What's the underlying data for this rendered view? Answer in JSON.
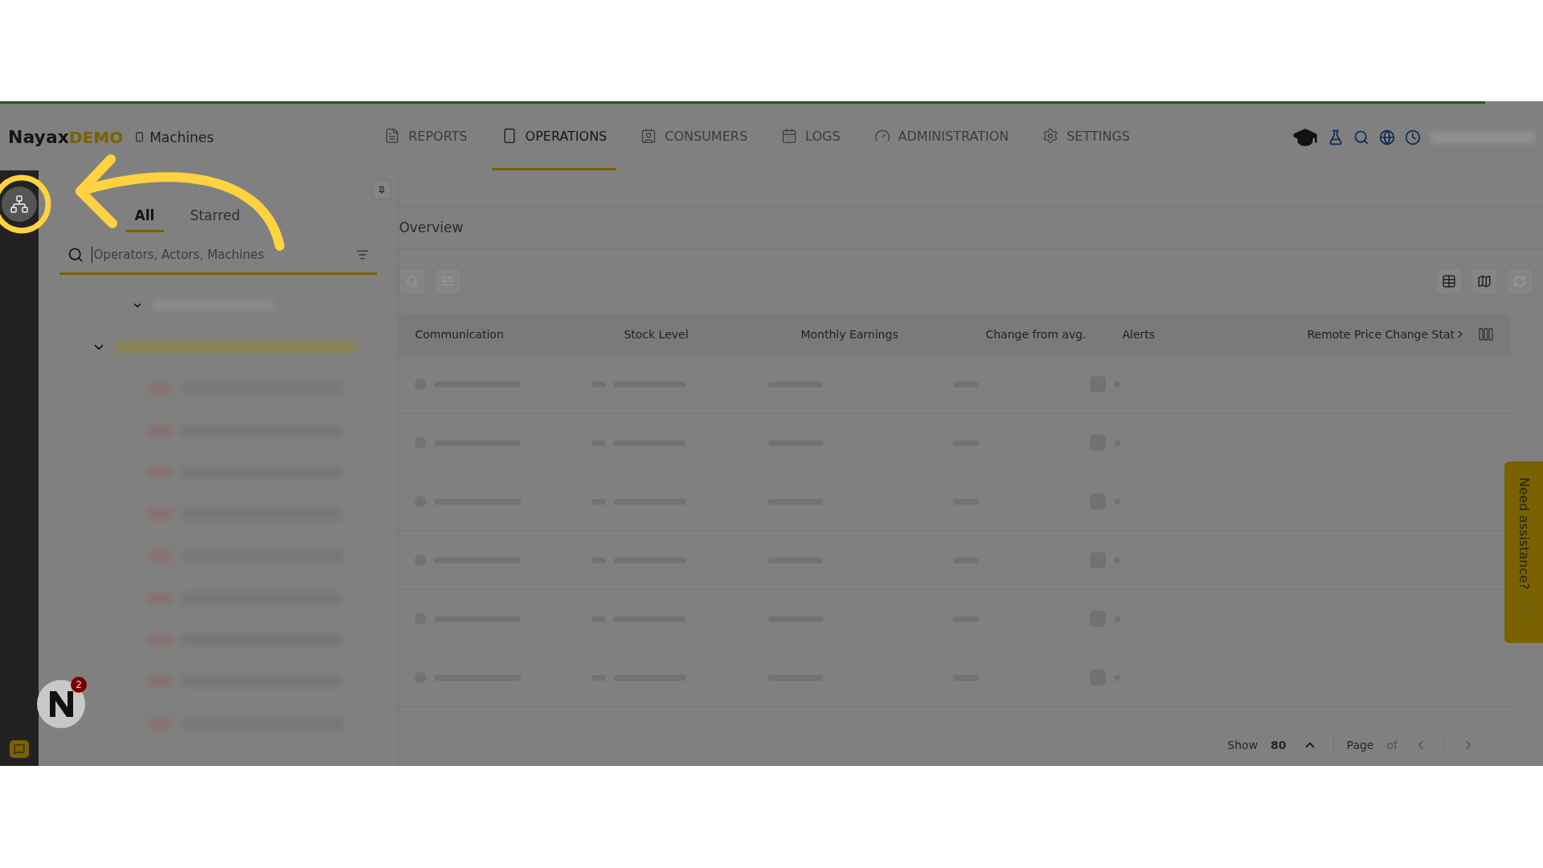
{
  "header": {
    "logo": {
      "brand": "Nayax",
      "suffix": "DEMO"
    },
    "breadcrumb": "Machines",
    "nav": [
      {
        "label": "REPORTS",
        "kind": "reports",
        "selected": false
      },
      {
        "label": "OPERATIONS",
        "kind": "operations",
        "selected": true
      },
      {
        "label": "CONSUMERS",
        "kind": "consumers",
        "selected": false
      },
      {
        "label": "LOGS",
        "kind": "logs",
        "selected": false
      },
      {
        "label": "ADMINISTRATION",
        "kind": "administration",
        "selected": false
      },
      {
        "label": "SETTINGS",
        "kind": "settings",
        "selected": false
      }
    ]
  },
  "tree_panel": {
    "tabs": [
      {
        "label": "All",
        "selected": true
      },
      {
        "label": "Starred",
        "selected": false
      }
    ],
    "search": {
      "placeholder": "Operators, Actors, Machines"
    },
    "items": [
      {
        "kind": "root"
      },
      {
        "kind": "group"
      },
      {
        "kind": "machine"
      },
      {
        "kind": "machine"
      },
      {
        "kind": "machine"
      },
      {
        "kind": "machine"
      },
      {
        "kind": "machine"
      },
      {
        "kind": "machine"
      },
      {
        "kind": "machine"
      },
      {
        "kind": "machine"
      },
      {
        "kind": "machine"
      }
    ]
  },
  "notification": {
    "count": "2"
  },
  "main": {
    "breadcrumb": "Overview",
    "table": {
      "columns": [
        "Communication",
        "Stock Level",
        "Monthly Earnings",
        "Change from avg.",
        "Alerts",
        "Remote Price Change Stat"
      ],
      "rows": [
        {
          "kind": "skeleton"
        },
        {
          "kind": "skeleton"
        },
        {
          "kind": "skeleton"
        },
        {
          "kind": "skeleton"
        },
        {
          "kind": "skeleton"
        },
        {
          "kind": "skeleton"
        }
      ]
    },
    "pagination": {
      "show_label": "Show",
      "page_size": "80",
      "page_label": "Page",
      "of_label": "of"
    }
  },
  "help_tab": {
    "label": "Need assistance?"
  },
  "annotation": {
    "kind": "arrow"
  }
}
